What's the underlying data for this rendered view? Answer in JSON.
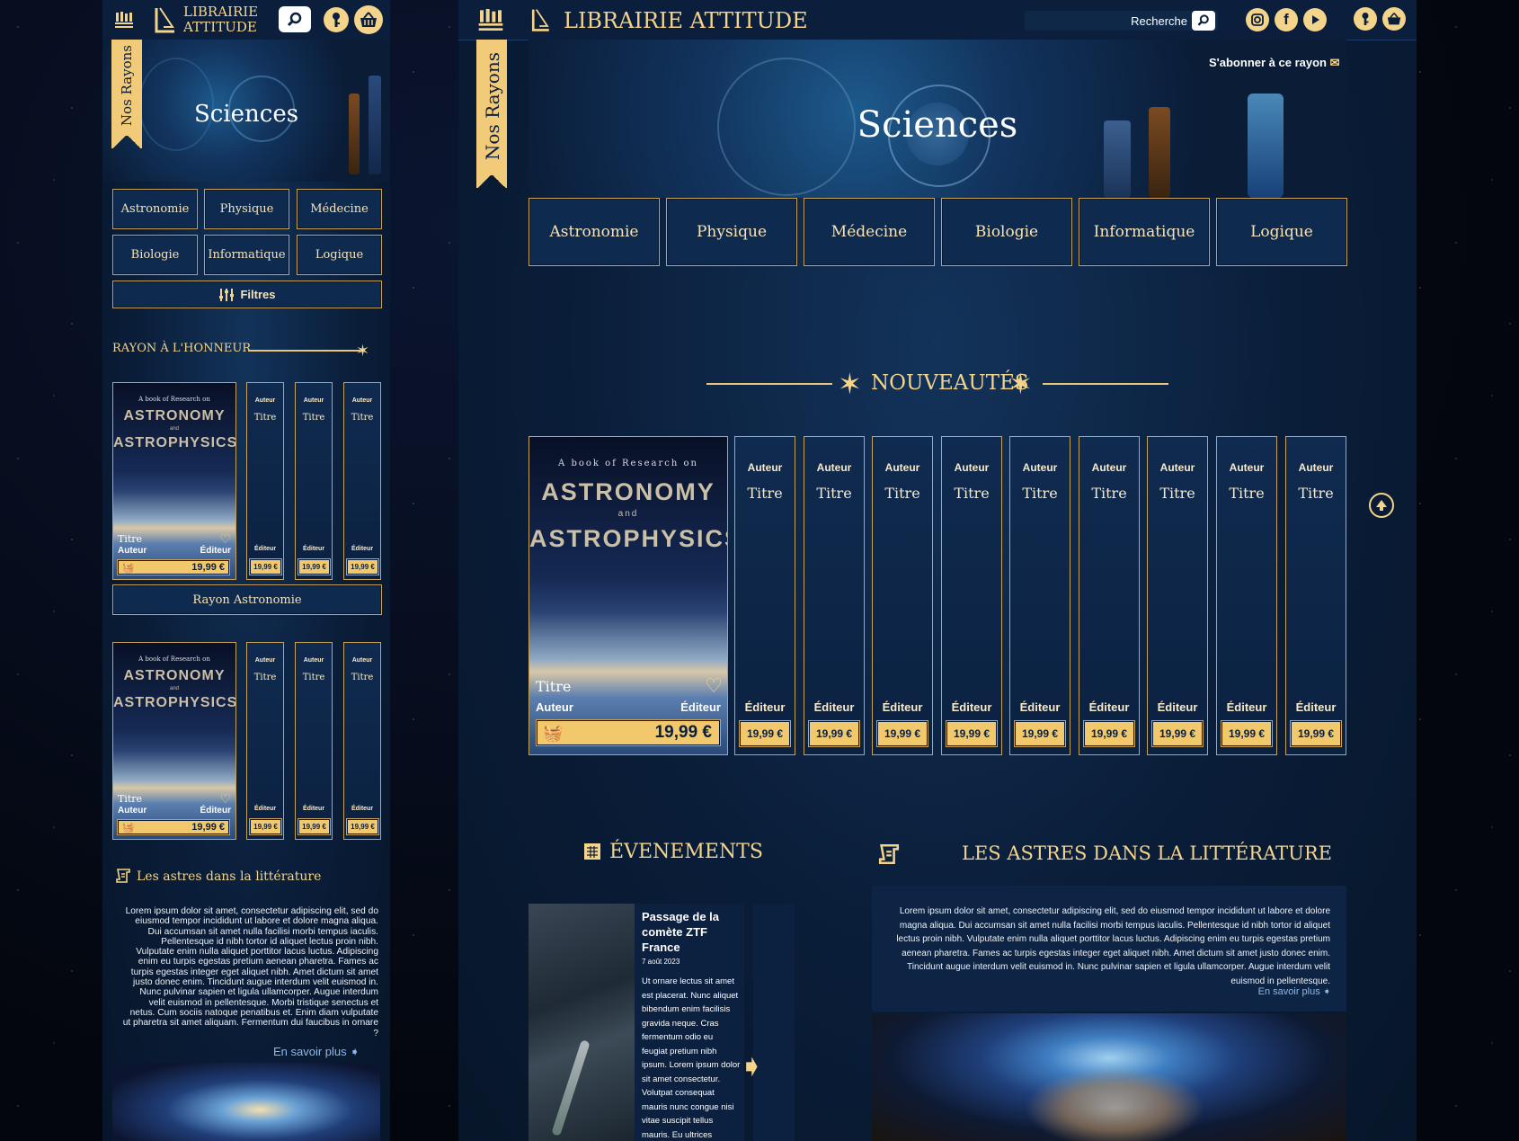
{
  "brand": {
    "line1": "LIBRAIRIE",
    "line2": "ATTITUDE",
    "full": "LIBRAIRIE ATTITUDE"
  },
  "search": {
    "label": "Recherche"
  },
  "ribbon": {
    "label": "Nos Rayons"
  },
  "subscribe": {
    "label": "S'abonner à ce rayon"
  },
  "hero": {
    "title": "Sciences"
  },
  "categories": [
    "Astronomie",
    "Physique",
    "Médecine",
    "Biologie",
    "Informatique",
    "Logique"
  ],
  "filters": {
    "label": "Filtres"
  },
  "featured": {
    "heading": "RAYON À L'HONNEUR",
    "shelf_button": "Rayon Astronomie"
  },
  "book": {
    "cover_line1": "A book of Research on",
    "cover_line2": "ASTRONOMY",
    "cover_line3": "and",
    "cover_line4": "ASTROPHYSICS",
    "title": "Titre",
    "author": "Auteur",
    "publisher": "Éditeur",
    "price": "19,99 €"
  },
  "news": {
    "heading": "NOUVEAUTÉS"
  },
  "events": {
    "heading": "ÉVENEMENTS",
    "item_title": "Passage de la comète ZTF France",
    "item_date": "7 août 2023",
    "item_body": "Ut ornare lectus sit amet est placerat. Nunc aliquet bibendum enim facilisis gravida neque. Cras fermentum odio eu feugiat pretium nibh ipsum. Lorem ipsum dolor sit amet consectetur. Volutpat consequat mauris nunc congue nisi vitae suscipit tellus mauris. Eu ultrices"
  },
  "literature": {
    "heading_mobile": "Les astres dans la littérature",
    "heading_desktop": "LES ASTRES DANS LA LITTÉRATURE",
    "body_mobile": "Lorem ipsum dolor sit amet, consectetur adipiscing elit, sed do eiusmod tempor incididunt ut labore et dolore magna aliqua. Dui accumsan sit amet nulla facilisi morbi tempus iaculis. Pellentesque id nibh tortor id aliquet lectus proin nibh. Vulputate enim nulla aliquet porttitor lacus luctus. Adipiscing enim eu turpis egestas pretium aenean pharetra. Fames ac turpis egestas integer eget aliquet nibh. Amet dictum sit amet justo donec enim. Tincidunt augue interdum velit euismod in. Nunc pulvinar sapien et ligula ullamcorper. Augue interdum velit euismod in pellentesque. Morbi tristique senectus et netus. Cum sociis natoque penatibus et. Enim diam vulputate ut pharetra sit amet aliquam. Fermentum dui faucibus in ornare ?",
    "body_desktop": "Lorem ipsum dolor sit amet, consectetur adipiscing elit, sed do eiusmod tempor incididunt ut labore et dolore magna aliqua. Dui accumsan sit amet nulla facilisi morbi tempus iaculis. Pellentesque id nibh tortor id aliquet lectus proin nibh. Vulputate enim nulla aliquet porttitor lacus luctus. Adipiscing enim eu turpis egestas pretium aenean pharetra. Fames ac turpis egestas integer eget aliquet nibh. Amet dictum sit amet justo donec enim. Tincidunt augue interdum velit euismod in. Nunc pulvinar sapien et ligula ullamcorper. Augue interdum velit euismod in pellentesque.",
    "more": "En savoir plus"
  },
  "colors": {
    "gold": "#f2c86d",
    "navy": "#0a1d38",
    "accent": "#c9a25a"
  }
}
